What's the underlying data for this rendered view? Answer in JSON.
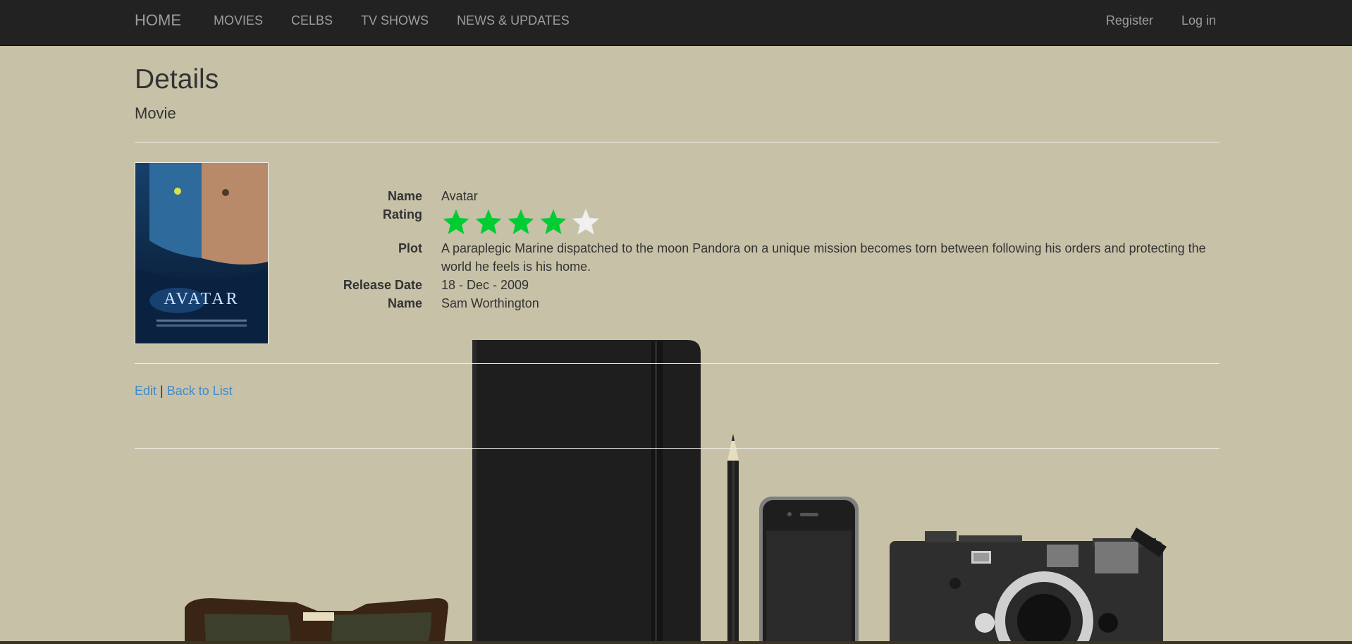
{
  "nav": {
    "brand": "HOME",
    "links": [
      "MOVIES",
      "CELBS",
      "TV SHOWS",
      "NEWS & UPDATES"
    ],
    "right": [
      "Register",
      "Log in"
    ]
  },
  "page": {
    "title": "Details",
    "subtitle": "Movie"
  },
  "poster": {
    "title_text": "AVATAR",
    "icon": "movie-poster-image"
  },
  "details": {
    "name_label": "Name",
    "name_value": "Avatar",
    "rating_label": "Rating",
    "rating_value": 4,
    "rating_max": 5,
    "plot_label": "Plot",
    "plot_value": "A paraplegic Marine dispatched to the moon Pandora on a unique mission becomes torn between following his orders and protecting the world he feels is his home.",
    "release_label": "Release Date",
    "release_value": "18 - Dec - 2009",
    "actor_label": "Name",
    "actor_value": "Sam Worthington"
  },
  "actions": {
    "edit": "Edit",
    "separator": "|",
    "back": "Back to List"
  },
  "colors": {
    "background": "#c7c1a7",
    "navbar": "#222222",
    "star_filled": "#00cc33",
    "star_empty": "#f0f0f0",
    "link": "#428bca"
  }
}
